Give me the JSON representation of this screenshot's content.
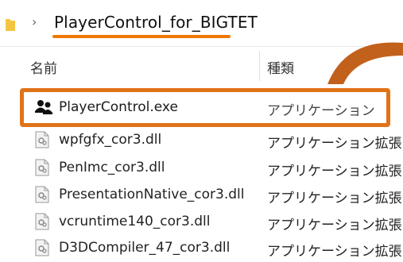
{
  "breadcrumb": {
    "path": "PlayerControl_for_BIGTET"
  },
  "columns": {
    "name": "名前",
    "type": "種類"
  },
  "files": [
    {
      "name": "PlayerControl.exe",
      "type": "アプリケーション",
      "icon": "players-icon",
      "highlighted": true
    },
    {
      "name": "wpfgfx_cor3.dll",
      "type": "アプリケーション拡張",
      "icon": "dll-file-icon"
    },
    {
      "name": "PenImc_cor3.dll",
      "type": "アプリケーション拡張",
      "icon": "dll-file-icon"
    },
    {
      "name": "PresentationNative_cor3.dll",
      "type": "アプリケーション拡張",
      "icon": "dll-file-icon"
    },
    {
      "name": "vcruntime140_cor3.dll",
      "type": "アプリケーション拡張",
      "icon": "dll-file-icon"
    },
    {
      "name": "D3DCompiler_47_cor3.dll",
      "type": "アプリケーション拡張",
      "icon": "dll-file-icon"
    }
  ],
  "colors": {
    "highlight": "#e07318",
    "underline": "#f07800",
    "arrow": "#c2611c"
  }
}
